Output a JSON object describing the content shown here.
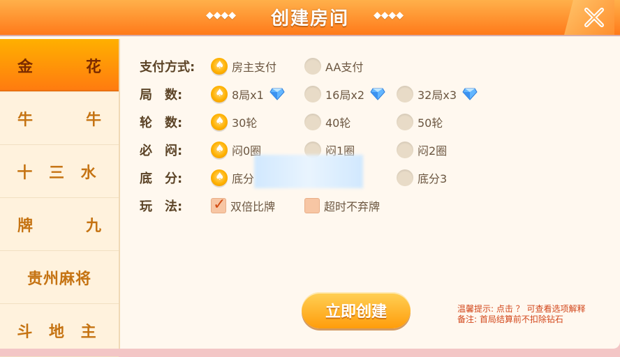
{
  "header": {
    "title": "创建房间",
    "deco_left": "◆◆◆◆",
    "deco_right": "◆◆◆◆"
  },
  "sidebar": {
    "items": [
      {
        "label_left": "金",
        "label_right": "花",
        "active": true
      },
      {
        "label_left": "牛",
        "label_right": "牛",
        "active": false
      },
      {
        "label": "十 三 水",
        "active": false
      },
      {
        "label_left": "牌",
        "label_right": "九",
        "active": false
      },
      {
        "label": "贵州麻将",
        "active": false
      },
      {
        "label": "斗 地 主",
        "active": false
      }
    ]
  },
  "form": {
    "pay": {
      "label": "支付方式:",
      "opt1": "房主支付",
      "opt2": "AA支付"
    },
    "rounds": {
      "label": "局　数:",
      "opt1": "8局x1",
      "opt2": "16局x2",
      "opt3": "32局x3"
    },
    "turns": {
      "label": "轮　数:",
      "opt1": "30轮",
      "opt2": "40轮",
      "opt3": "50轮"
    },
    "must_peek": {
      "label": "必　闷:",
      "opt1": "闷0圈",
      "opt2": "闷1圈",
      "opt3": "闷2圈"
    },
    "base": {
      "label": "底　分:",
      "opt1": "底分",
      "opt3": "底分3"
    },
    "play": {
      "label": "玩　法:",
      "opt1": "双倍比牌",
      "opt2": "超时不弃牌"
    }
  },
  "actions": {
    "create_label": "立即创建"
  },
  "tips": {
    "line1": "温馨提示: 点击 ？ 可查看选项解释",
    "line2": "备注: 首局结算前不扣除钻石"
  }
}
